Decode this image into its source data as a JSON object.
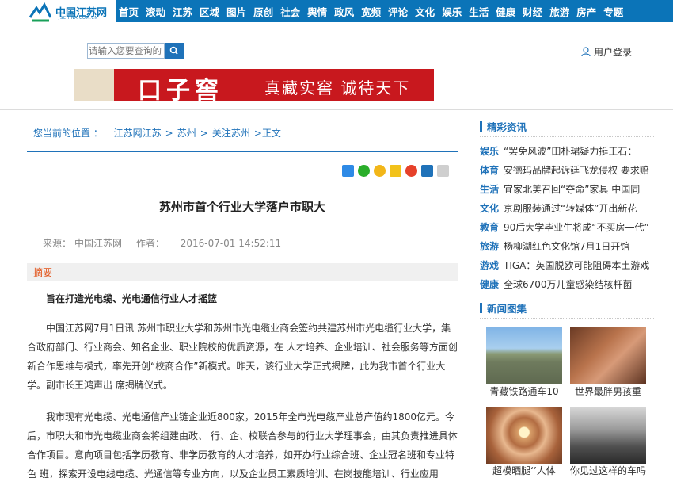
{
  "site": {
    "logo_text": "中国江苏网",
    "logo_sub": "JSCHINA.COM.CN"
  },
  "nav": [
    "首页",
    "滚动",
    "江苏",
    "区域",
    "图片",
    "原创",
    "社会",
    "舆情",
    "政风",
    "宽频",
    "评论",
    "文化",
    "娱乐",
    "生活",
    "健康",
    "财经",
    "旅游",
    "房产",
    "专题"
  ],
  "search": {
    "placeholder": "请输入您要查询的"
  },
  "user": {
    "login_label": "用户登录"
  },
  "banner": {
    "brand": "口子窖",
    "slogan": "真藏实窖  诚待天下"
  },
  "breadcrumb": {
    "prefix": "您当前的位置 ：",
    "items": [
      "江苏网江苏",
      "苏州",
      "关注苏州",
      "正文"
    ]
  },
  "article": {
    "title": "苏州市首个行业大学落户市职大",
    "source_label": "来源：",
    "source": "中国江苏网",
    "author_label": "作者：",
    "author": "",
    "date": "2016-07-01 14:52:11",
    "summary_label": "摘要",
    "summary": "旨在打造光电缆、光电通信行业人才摇篮",
    "paragraphs": [
      "中国江苏网7月1日讯  苏州市职业大学和苏州市光电缆业商会签约共建苏州市光电缆行业大学，集合政府部门、行业商会、知名企业、职业院校的优质资源，在 人才培养、企业培训、社会服务等方面创新合作思维与模式，率先开创“校商合作”新模式。昨天，该行业大学正式揭牌，此为我市首个行业大学。副市长王鸿声出 席揭牌仪式。",
      "我市现有光电缆、光电通信产业链企业近800家，2015年全市光电缆产业总产值约1800亿元。今后，市职大和市光电缆业商会将组建由政、 行、企、校联合参与的行业大学理事会，由其负责推进具体合作项目。意向项目包括学历教育、非学历教育的人才培养，如开办行业综合班、企业冠名班和专业特色 班，探索开设电线电缆、光通信等专业方向，以及企业员工素质培训、在岗技能培训、行业应用"
    ]
  },
  "sidebar": {
    "featured_title": "精彩资讯",
    "news": [
      {
        "cat": "娱乐",
        "text": "“罢免风波”田朴珺疑力挺王石："
      },
      {
        "cat": "体育",
        "text": "安德玛品牌起诉廷飞龙侵权 要求赔"
      },
      {
        "cat": "生活",
        "text": "宜家北美召回“夺命”家具 中国同"
      },
      {
        "cat": "文化",
        "text": "京剧服装通过“转媒体”开出新花"
      },
      {
        "cat": "教育",
        "text": "90后大学毕业生将成“不买房一代”"
      },
      {
        "cat": "旅游",
        "text": "杨柳湖红色文化馆7月1日开馆"
      },
      {
        "cat": "游戏",
        "text": "TIGA：英国脱欧可能阻碍本土游戏"
      },
      {
        "cat": "健康",
        "text": "全球6700万儿童感染结核杆菌"
      }
    ],
    "gallery_title": "新闻图集",
    "gallery": [
      "青藏铁路通车10",
      "世界最胖男孩重",
      "超模晒腿‘’人体",
      "你见过这样的车吗"
    ]
  },
  "colors": {
    "brand_blue": "#0b74b8",
    "accent_orange": "#e2541b",
    "banner_red": "#c8181e"
  }
}
